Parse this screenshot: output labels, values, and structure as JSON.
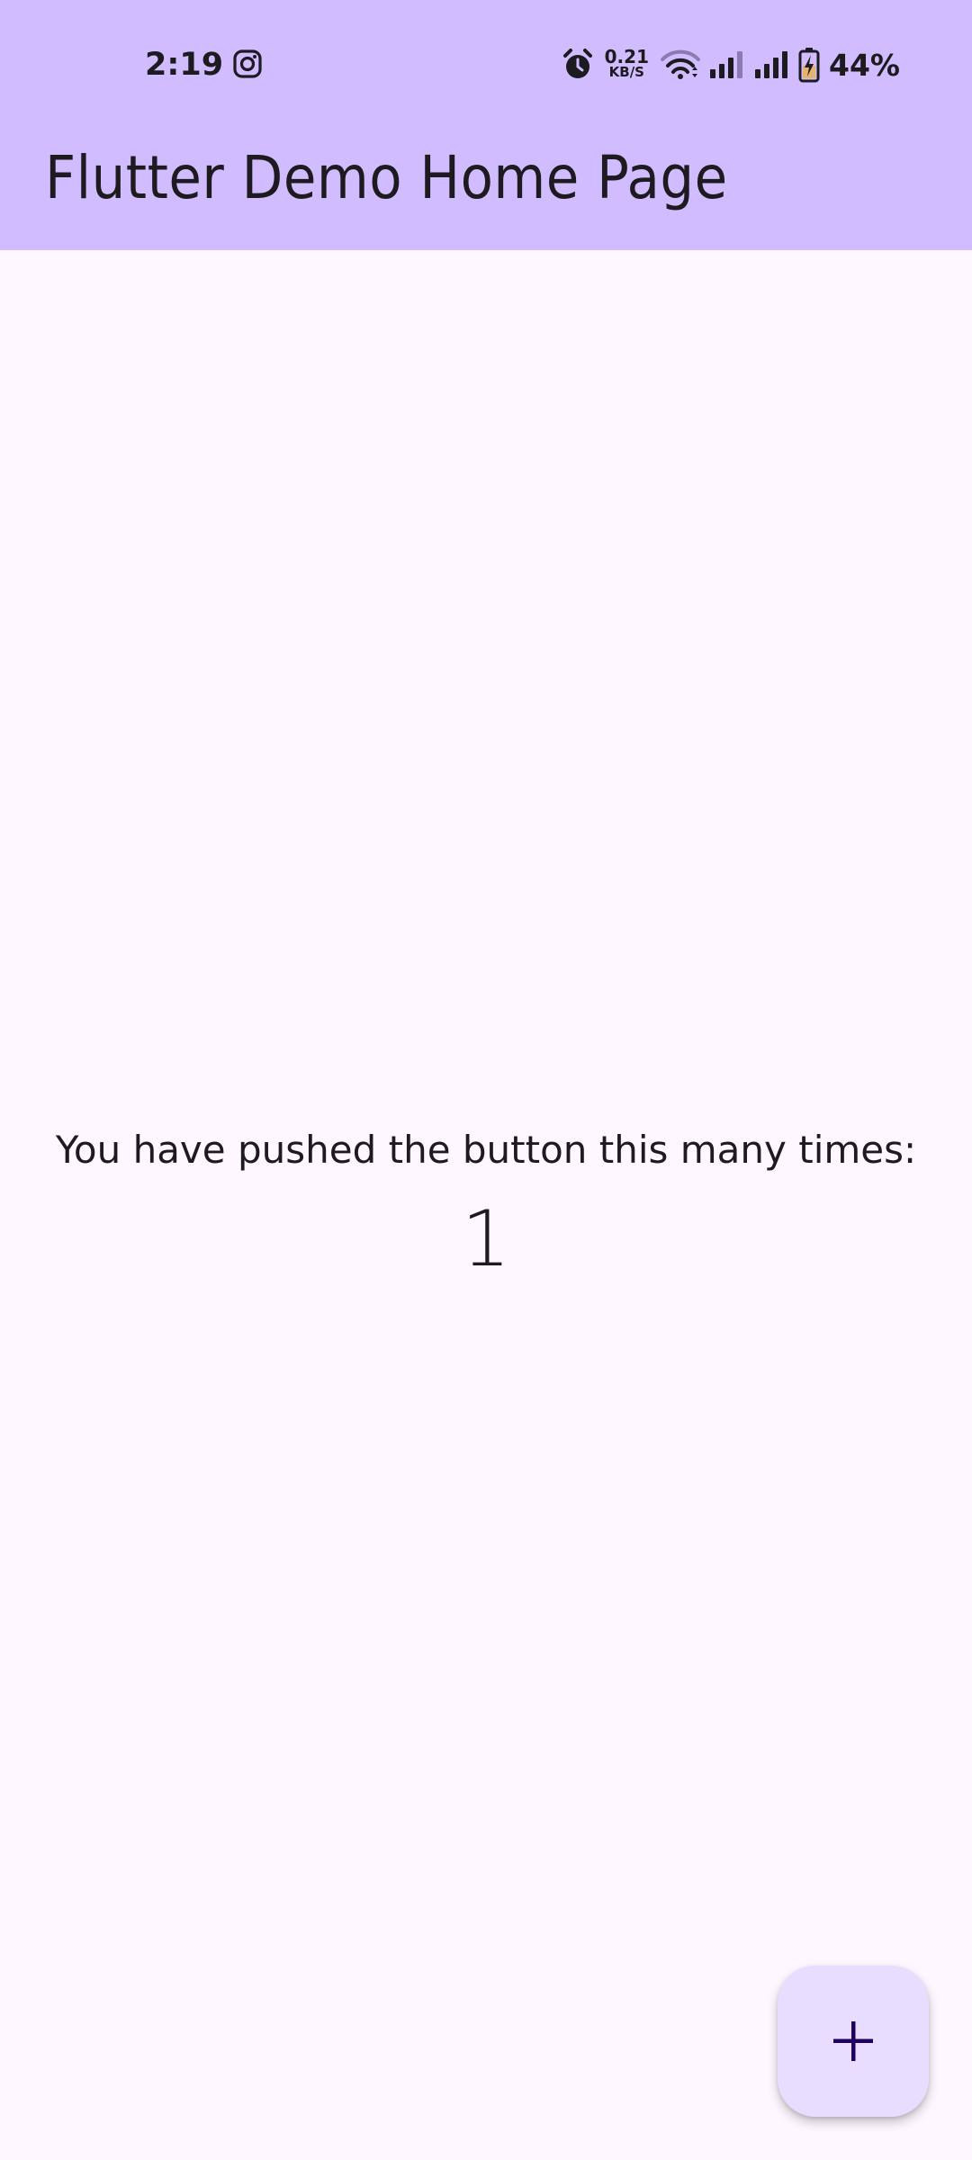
{
  "status_bar": {
    "time": "2:19",
    "notification_icon": "instagram-icon",
    "alarm_icon": "alarm-icon",
    "net_speed_value": "0.21",
    "net_speed_unit": "KB/S",
    "wifi_icon": "wifi-icon",
    "signal_icons": [
      "signal-sim1-icon",
      "signal-sim2-icon"
    ],
    "battery_icon": "battery-charging-icon",
    "battery_percent": "44%"
  },
  "app_bar": {
    "title": "Flutter Demo Home Page"
  },
  "body": {
    "message": "You have pushed the button this many times:",
    "counter": "1"
  },
  "fab": {
    "icon": "add-icon"
  },
  "colors": {
    "app_bar_bg": "#d1bcff",
    "page_bg": "#fef7ff",
    "fab_bg": "#e9ddff",
    "fab_icon": "#21005d",
    "text": "#1d1b20"
  }
}
